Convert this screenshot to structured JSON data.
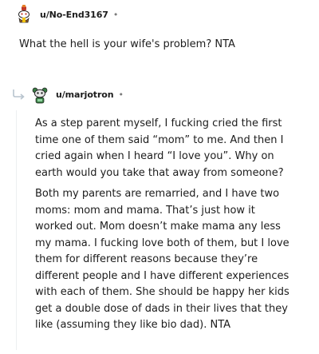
{
  "comments": [
    {
      "username": "u/No-End3167",
      "separator": "•",
      "text": "What the hell is your wife's problem? NTA"
    },
    {
      "username": "u/marjotron",
      "separator": "•",
      "paragraphs": [
        "As a step parent myself, I fucking cried the first time one of them said “mom” to me. And then I cried again when I heard “I love you”. Why on earth would you take that away from someone?",
        "Both my parents are remarried, and I have two moms: mom and mama. That’s just how it worked out. Mom doesn’t make mama any less my mama. I fucking love both of them, but I love them for different reasons because they’re different people and I have different experiences with each of them. She should be happy her kids get a double dose of dads in their lives that they like (assuming they like bio dad). NTA"
      ]
    }
  ],
  "icons": {
    "avatar1": "snoo-avatar-icon",
    "avatar2": "snoo-avatar-icon",
    "reply": "reply-arrow-icon"
  },
  "colors": {
    "text": "#1c1c1c",
    "meta": "#7c7c7c",
    "avatar1_accent": "#c0392b",
    "avatar2_accent": "#3a7d44"
  }
}
